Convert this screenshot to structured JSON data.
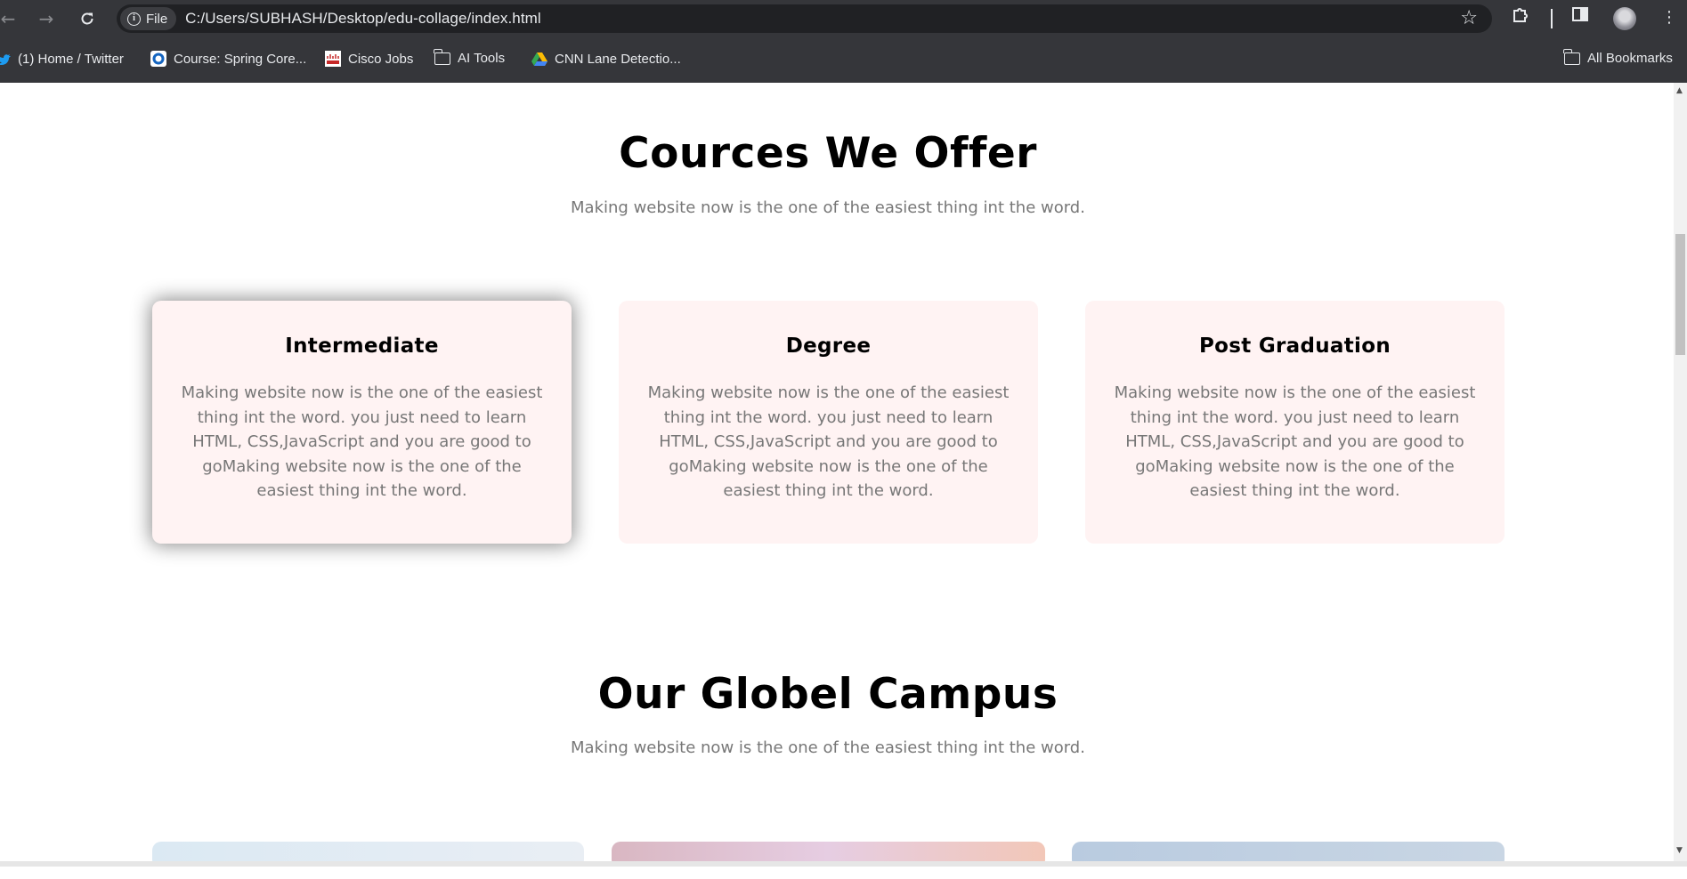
{
  "browser": {
    "site_chip": "File",
    "url": "C:/Users/SUBHASH/Desktop/edu-collage/index.html"
  },
  "bookmarks": [
    {
      "label": "(1) Home / Twitter",
      "icon": "twitter-icon"
    },
    {
      "label": "Course: Spring Core...",
      "icon": "course-site-icon"
    },
    {
      "label": "Cisco Jobs",
      "icon": "cisco-icon"
    },
    {
      "label": "AI Tools",
      "icon": "folder-icon"
    },
    {
      "label": "CNN Lane Detectio...",
      "icon": "google-drive-icon"
    }
  ],
  "all_bookmarks": "All Bookmarks",
  "courses": {
    "title": "Cources We Offer",
    "subtitle": "Making website now is the one of the easiest thing int the word.",
    "cards": [
      {
        "title": "Intermediate",
        "text": "Making website now is the one of the easiest thing int the word. you just need to learn HTML, CSS,JavaScript and you are good to goMaking website now is the one of the easiest thing int the word."
      },
      {
        "title": "Degree",
        "text": "Making website now is the one of the easiest thing int the word. you just need to learn HTML, CSS,JavaScript and you are good to goMaking website now is the one of the easiest thing int the word."
      },
      {
        "title": "Post Graduation",
        "text": "Making website now is the one of the easiest thing int the word. you just need to learn HTML, CSS,JavaScript and you are good to goMaking website now is the one of the easiest thing int the word."
      }
    ]
  },
  "campus": {
    "title": "Our Globel Campus",
    "subtitle": "Making website now is the one of the easiest thing int the word."
  },
  "colors": {
    "card_background": "#fff3f3",
    "chrome_background": "#35363a",
    "muted_text": "#777777"
  }
}
